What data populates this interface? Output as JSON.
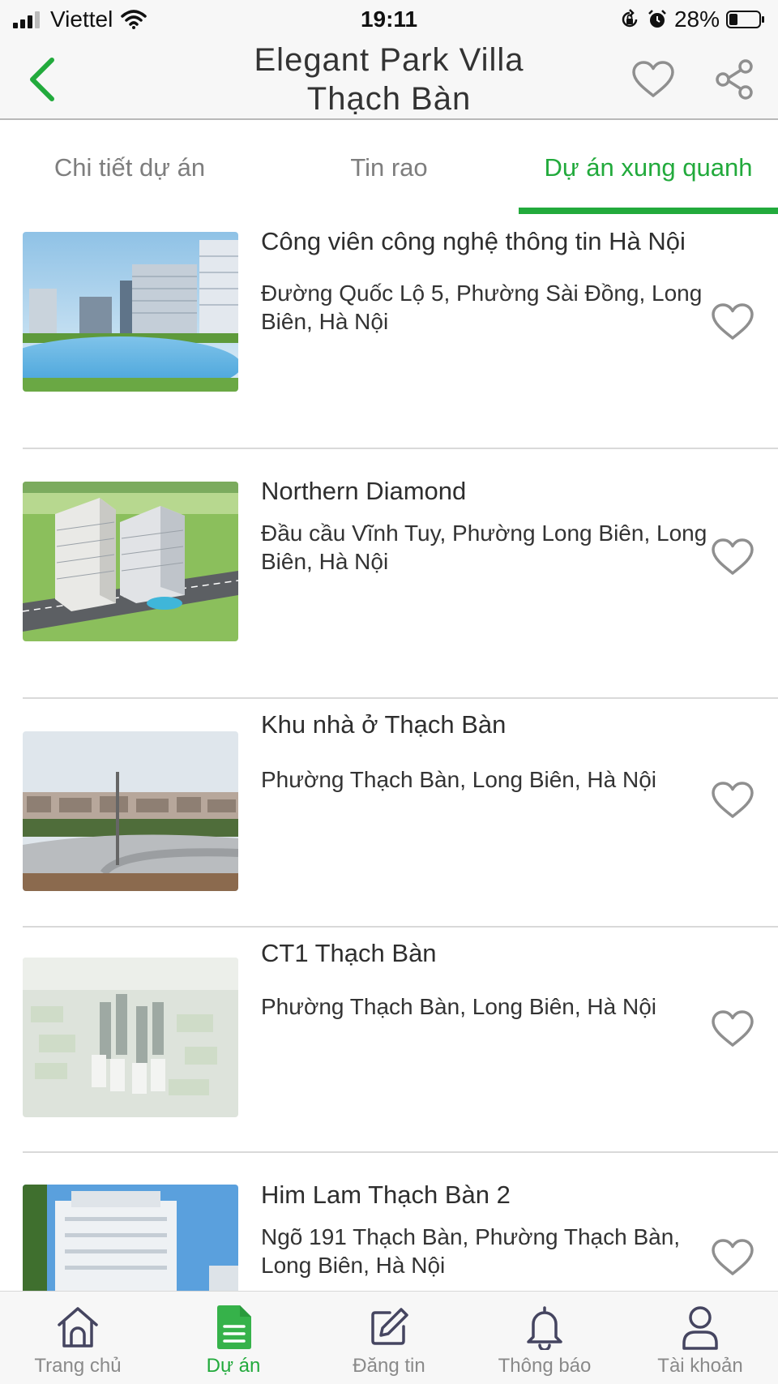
{
  "status_bar": {
    "carrier": "Viettel",
    "time": "19:11",
    "battery": "28%"
  },
  "header": {
    "title_line1": "Elegant Park Villa",
    "title_line2": "Thạch Bàn"
  },
  "tabs": [
    {
      "label": "Chi tiết dự án",
      "active": false
    },
    {
      "label": "Tin rao",
      "active": false
    },
    {
      "label": "Dự án xung quanh",
      "active": true
    }
  ],
  "projects": [
    {
      "title": "Công viên công nghệ thông tin Hà Nội",
      "address": "Đường Quốc Lộ 5, Phường Sài Đồng, Long Biên, Hà Nội",
      "thumbnail_icon": "photo-city-lake"
    },
    {
      "title": "Northern Diamond",
      "address": "Đầu cầu Vĩnh Tuy, Phường Long Biên, Long Biên, Hà Nội",
      "thumbnail_icon": "photo-twin-towers"
    },
    {
      "title": "Khu nhà ở Thạch Bàn",
      "address": "Phường Thạch Bàn, Long Biên, Hà Nội",
      "thumbnail_icon": "photo-housing-road"
    },
    {
      "title": "CT1 Thạch Bàn",
      "address": "Phường Thạch Bàn, Long Biên, Hà Nội",
      "thumbnail_icon": "photo-aerial-render"
    },
    {
      "title": "Him Lam Thạch Bàn 2",
      "address": "Ngõ 191 Thạch Bàn, Phường Thạch Bàn, Long Biên, Hà Nội",
      "thumbnail_icon": "photo-high-rise"
    }
  ],
  "bottom_nav": [
    {
      "label": "Trang chủ",
      "icon": "home-icon",
      "active": false
    },
    {
      "label": "Dự án",
      "icon": "document-icon",
      "active": true
    },
    {
      "label": "Đăng tin",
      "icon": "edit-icon",
      "active": false
    },
    {
      "label": "Thông báo",
      "icon": "bell-icon",
      "active": false
    },
    {
      "label": "Tài khoản",
      "icon": "user-icon",
      "active": false
    }
  ],
  "colors": {
    "accent": "#22aa3c",
    "inactive_text": "#7e7e7e",
    "icon_gray": "#8f8f8f",
    "divider": "#d9d9d9"
  }
}
